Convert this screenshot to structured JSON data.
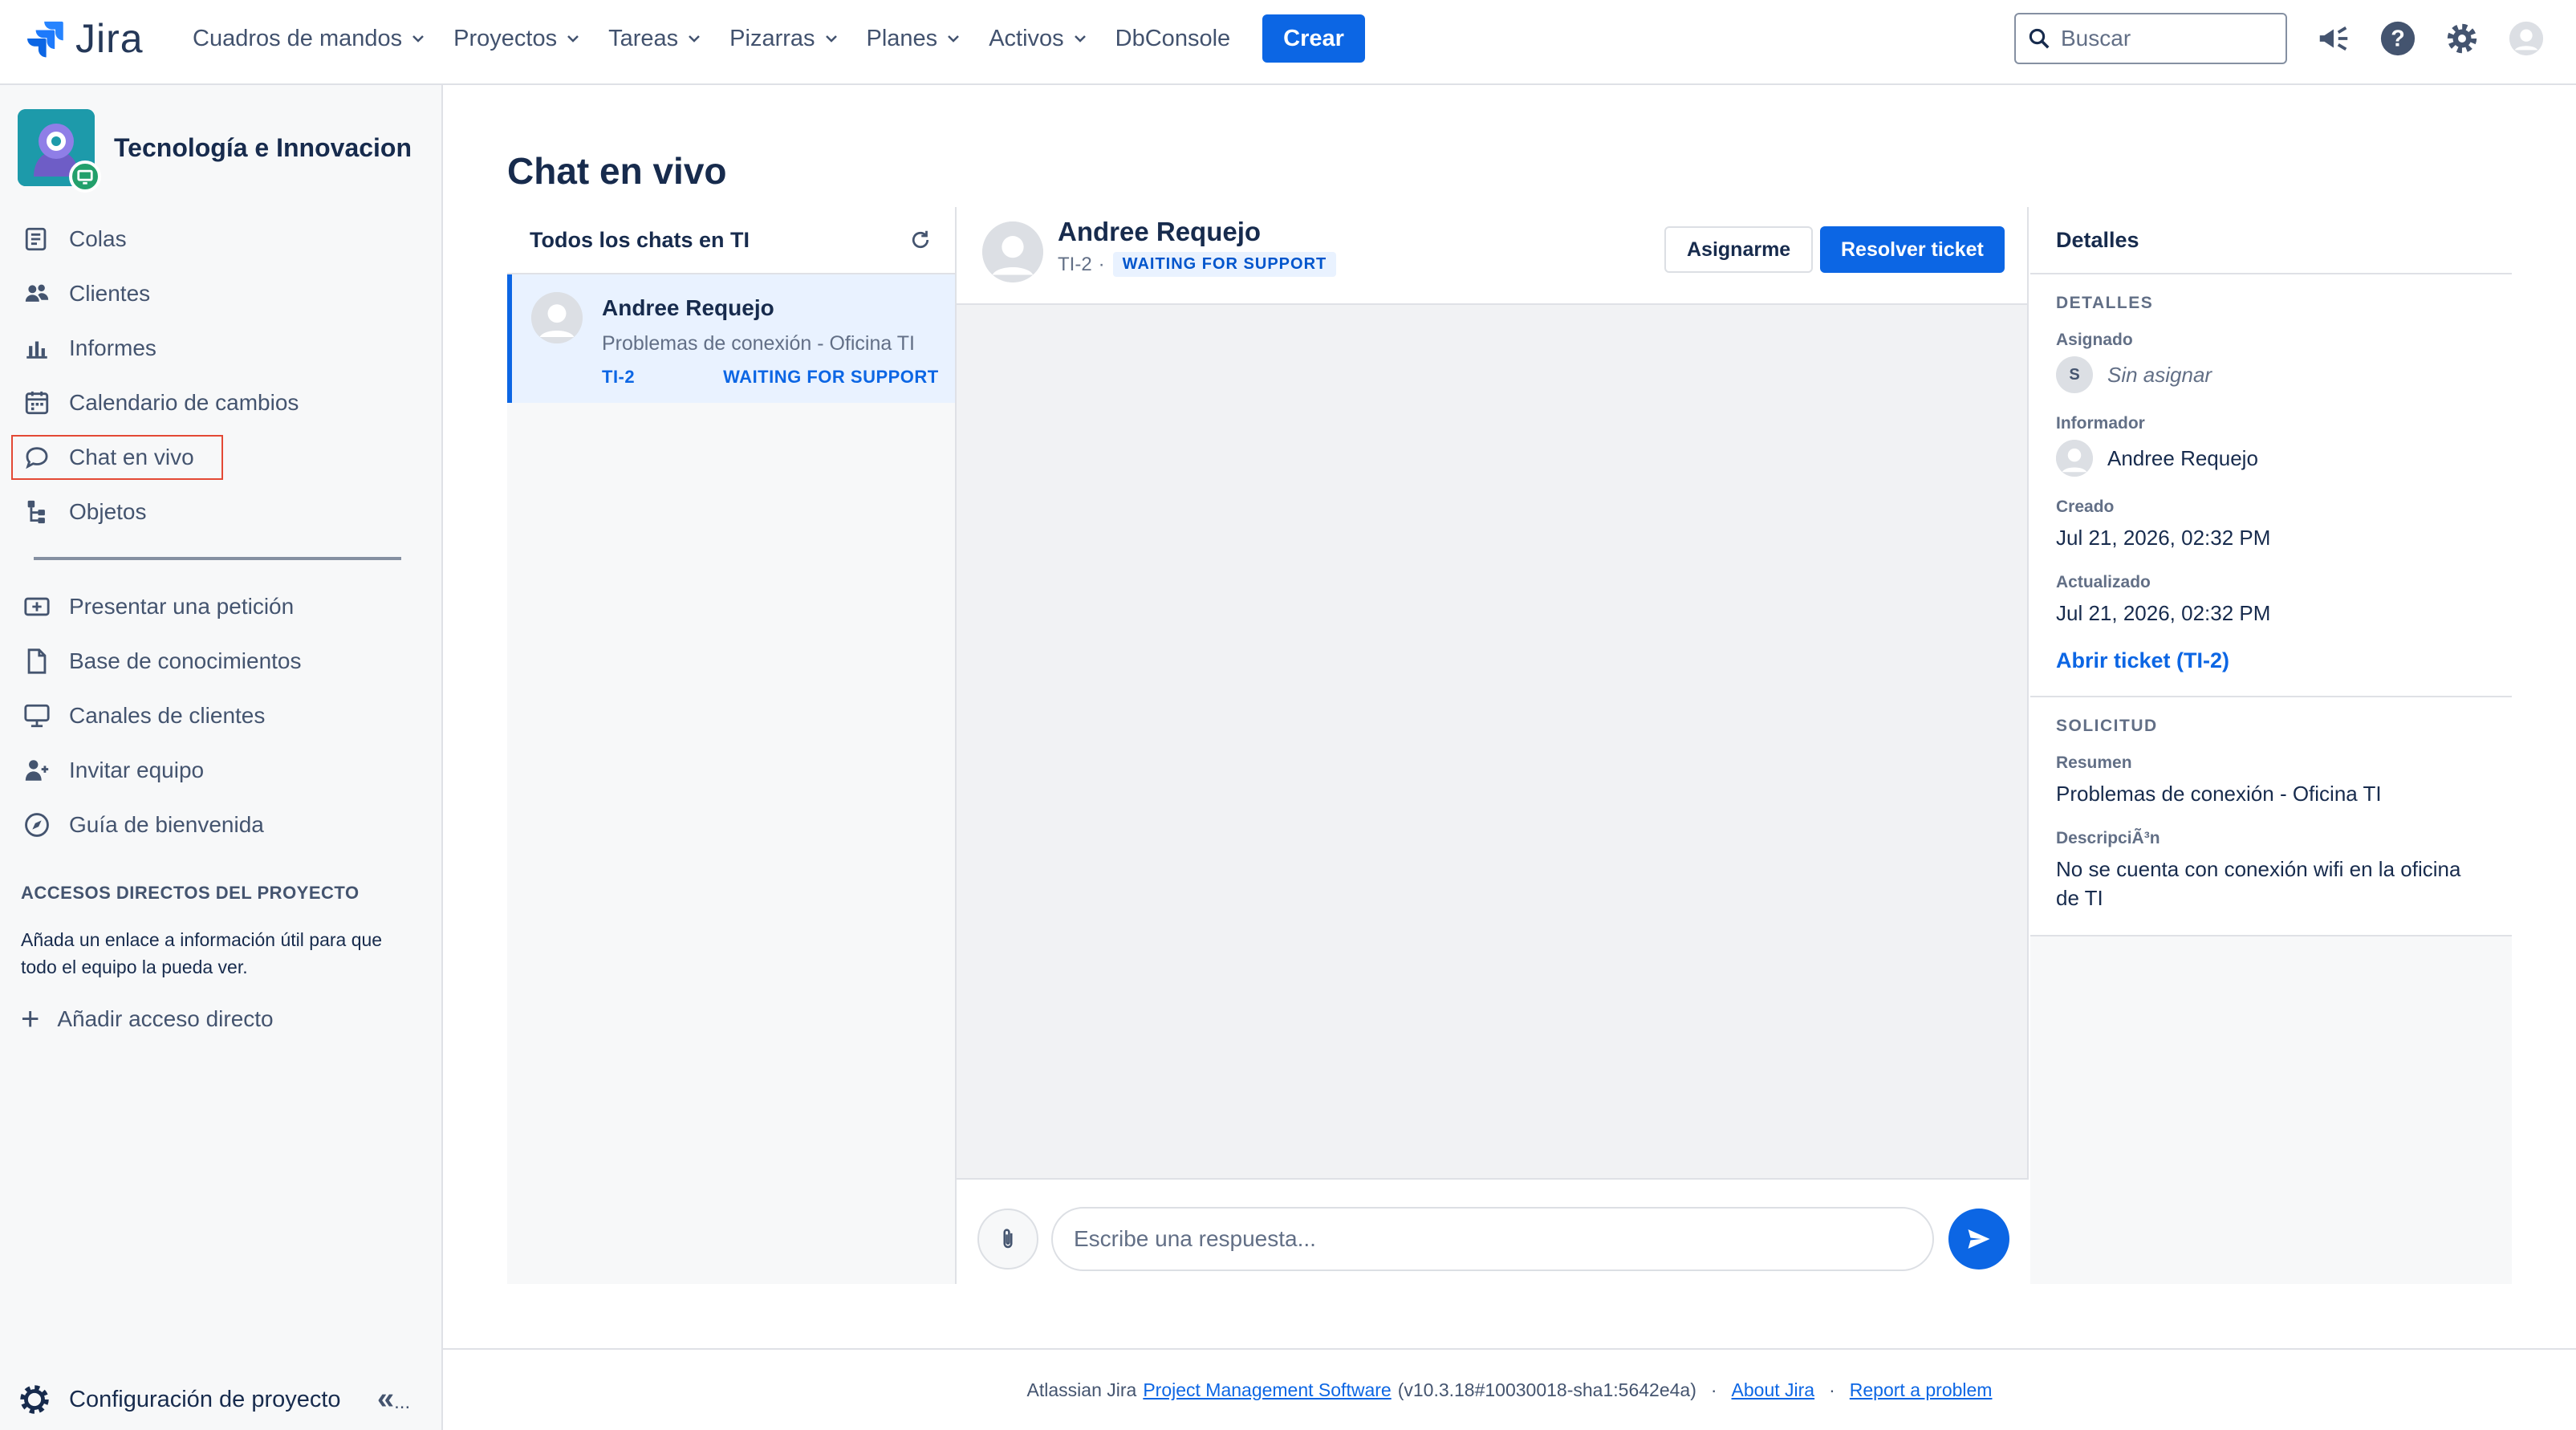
{
  "topnav": {
    "logo_text": "Jira",
    "items": [
      {
        "label": "Cuadros de mandos",
        "dropdown": true
      },
      {
        "label": "Proyectos",
        "dropdown": true
      },
      {
        "label": "Tareas",
        "dropdown": true
      },
      {
        "label": "Pizarras",
        "dropdown": true
      },
      {
        "label": "Planes",
        "dropdown": true
      },
      {
        "label": "Activos",
        "dropdown": true
      },
      {
        "label": "DbConsole",
        "dropdown": false
      }
    ],
    "create_label": "Crear",
    "search_placeholder": "Buscar",
    "icons": [
      "megaphone-icon",
      "help-icon",
      "settings-icon",
      "user-avatar-icon"
    ]
  },
  "sidebar": {
    "project_name": "Tecnología e Innovacion",
    "items": [
      {
        "label": "Colas",
        "icon": "queue-icon"
      },
      {
        "label": "Clientes",
        "icon": "customers-icon"
      },
      {
        "label": "Informes",
        "icon": "reports-icon"
      },
      {
        "label": "Calendario de cambios",
        "icon": "calendar-icon"
      },
      {
        "label": "Chat en vivo",
        "icon": "chat-icon",
        "selected": true
      },
      {
        "label": "Objetos",
        "icon": "objects-icon"
      }
    ],
    "items2": [
      {
        "label": "Presentar una petición",
        "icon": "raise-request-icon"
      },
      {
        "label": "Base de conocimientos",
        "icon": "knowledge-base-icon"
      },
      {
        "label": "Canales de clientes",
        "icon": "channels-icon"
      },
      {
        "label": "Invitar equipo",
        "icon": "invite-team-icon"
      },
      {
        "label": "Guía de bienvenida",
        "icon": "compass-icon"
      }
    ],
    "shortcuts_title": "ACCESOS DIRECTOS DEL PROYECTO",
    "shortcuts_text": "Añada un enlace a información útil para que todo el equipo la pueda ver.",
    "add_shortcut": "Añadir acceso directo",
    "footer_label": "Configuración de proyecto",
    "collapse_glyph": "«",
    "more_glyph": "..."
  },
  "main": {
    "title": "Chat en vivo",
    "chat_list": {
      "header": "Todos los chats en TI",
      "items": [
        {
          "name": "Andree Requejo",
          "summary": "Problemas de conexión - Oficina TI",
          "key": "TI-2",
          "status": "WAITING FOR SUPPORT"
        }
      ]
    },
    "conversation": {
      "name": "Andree Requejo",
      "key": "TI-2",
      "separator": "·",
      "status": "WAITING FOR SUPPORT",
      "assign_label": "Asignarme",
      "resolve_label": "Resolver ticket",
      "reply_placeholder": "Escribe una respuesta..."
    },
    "details": {
      "header": "Detalles",
      "section1_title": "DETALLES",
      "assignee_label": "Asignado",
      "assignee_initial": "S",
      "assignee_value": "Sin asignar",
      "reporter_label": "Informador",
      "reporter_value": "Andree Requejo",
      "created_label": "Creado",
      "created_value": "Jul 21, 2026, 02:32 PM",
      "updated_label": "Actualizado",
      "updated_value": "Jul 21, 2026, 02:32 PM",
      "open_link": "Abrir ticket (TI-2)",
      "section2_title": "SOLICITUD",
      "summary_label": "Resumen",
      "summary_value": "Problemas de conexión - Oficina TI",
      "description_label": "DescripciÃ³n",
      "description_value": "No se cuenta con conexión wifi en la oficina de TI"
    }
  },
  "footer": {
    "prefix": "Atlassian Jira",
    "link1": "Project Management Software",
    "version": "(v10.3.18#10030018-sha1:5642e4a)",
    "dot": "·",
    "link2": "About Jira",
    "link3": "Report a problem"
  },
  "colors": {
    "brand": "#0C66E4",
    "selected_bg": "#E9F2FF",
    "highlight_outline": "#E34935",
    "project_avatar": "#1D9AAA",
    "channel_badge": "#22A06B"
  }
}
